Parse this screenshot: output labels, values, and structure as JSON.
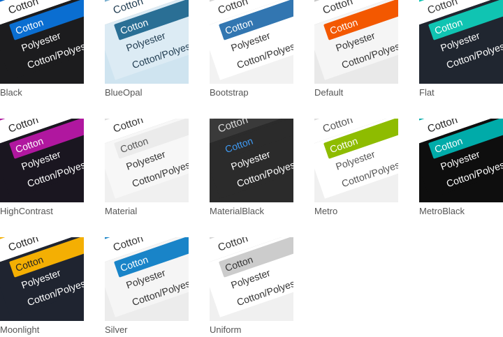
{
  "options": {
    "cotton_input": "Cotton",
    "cotton": "Cotton",
    "polyester": "Polyester",
    "blend": "Cotton/Polyester"
  },
  "themes": [
    {
      "name": "Black",
      "bg": "#1c1c1e",
      "inbg": "#ffffff",
      "intext": "#222222",
      "inborder": "#0066cc",
      "popbg": "#1c1c1e",
      "selbg": "#0a6ed1",
      "seltext": "#ffffff",
      "optcolor": "#ffffff"
    },
    {
      "name": "BlueOpal",
      "bg": "#cfe4f0",
      "inbg": "#ffffff",
      "intext": "#1e3a4f",
      "inborder": "#7ab0cf",
      "popbg": "#dcebf4",
      "selbg": "#2a6f95",
      "seltext": "#ffffff",
      "optcolor": "#1e3a4f"
    },
    {
      "name": "Bootstrap",
      "bg": "#f2f2f2",
      "inbg": "#ffffff",
      "intext": "#333333",
      "inborder": "#d5d5d5",
      "popbg": "#ffffff",
      "selbg": "#3276b1",
      "seltext": "#ffffff",
      "optcolor": "#333333"
    },
    {
      "name": "Default",
      "bg": "#e9e9e9",
      "inbg": "#ffffff",
      "intext": "#333333",
      "inborder": "#c9c9c9",
      "popbg": "#f5f5f5",
      "selbg": "#f35800",
      "seltext": "#ffffff",
      "optcolor": "#333333"
    },
    {
      "name": "Flat",
      "bg": "#202630",
      "inbg": "#ffffff",
      "intext": "#333333",
      "inborder": "#10c4b2",
      "popbg": "#202630",
      "selbg": "#10c4b2",
      "seltext": "#ffffff",
      "optcolor": "#ffffff"
    },
    {
      "name": "HighContrast",
      "bg": "#1a1620",
      "inbg": "#ffffff",
      "intext": "#222222",
      "inborder": "#b0179f",
      "popbg": "#1a1620",
      "selbg": "#b0179f",
      "seltext": "#ffffff",
      "optcolor": "#ffffff"
    },
    {
      "name": "Material",
      "bg": "#f0f0f0",
      "inbg": "#ffffff",
      "intext": "#333333",
      "inborder": "#dddddd",
      "popbg": "#f7f7f7",
      "selbg": "#ebebeb",
      "seltext": "#555555",
      "optcolor": "#333333"
    },
    {
      "name": "MaterialBlack",
      "bg": "#2b2b2b",
      "inbg": "#3a3a3a",
      "intext": "#dddddd",
      "inborder": "#444444",
      "popbg": "#2b2b2b",
      "selbg": "#2b2b2b",
      "seltext": "#3f9bf5",
      "optcolor": "#ffffff"
    },
    {
      "name": "Metro",
      "bg": "#f0f0f0",
      "inbg": "#ffffff",
      "intext": "#555555",
      "inborder": "#dddddd",
      "popbg": "#ffffff",
      "selbg": "#8ebc00",
      "seltext": "#ffffff",
      "optcolor": "#555555"
    },
    {
      "name": "MetroBlack",
      "bg": "#0e0e0e",
      "inbg": "#ffffff",
      "intext": "#222222",
      "inborder": "#00aba9",
      "popbg": "#0e0e0e",
      "selbg": "#00aba9",
      "seltext": "#ffffff",
      "optcolor": "#ffffff"
    },
    {
      "name": "Moonlight",
      "bg": "#1f2430",
      "inbg": "#ffffff",
      "intext": "#222222",
      "inborder": "#f4af03",
      "popbg": "#1f2430",
      "selbg": "#f4af03",
      "seltext": "#222222",
      "optcolor": "#ffffff"
    },
    {
      "name": "Silver",
      "bg": "#ececec",
      "inbg": "#ffffff",
      "intext": "#333333",
      "inborder": "#1984c8",
      "popbg": "#f5f5f5",
      "selbg": "#1984c8",
      "seltext": "#ffffff",
      "optcolor": "#333333"
    },
    {
      "name": "Uniform",
      "bg": "#f0f0f0",
      "inbg": "#ffffff",
      "intext": "#333333",
      "inborder": "#d5d5d5",
      "popbg": "#ffffff",
      "selbg": "#cccccc",
      "seltext": "#333333",
      "optcolor": "#333333"
    }
  ]
}
